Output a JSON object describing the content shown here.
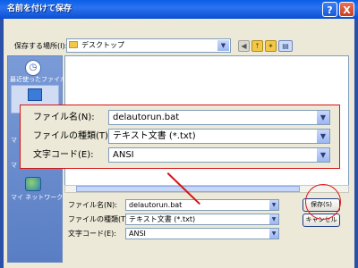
{
  "window": {
    "title": "名前を付けて保存",
    "help_glyph": "?",
    "close_glyph": "X"
  },
  "look_in": {
    "label": "保存する場所(I):",
    "value": "デスクトップ"
  },
  "toolbar": {
    "icons": [
      "back-icon",
      "up-folder-icon",
      "new-folder-icon",
      "view-menu-icon"
    ]
  },
  "places": {
    "recent_label": "最近使ったファイル",
    "partial_label_1": "マ",
    "partial_label_2": "マ",
    "network_label": "マイ ネットワーク"
  },
  "form": {
    "filename_label": "ファイル名(N):",
    "filename_value": "delautorun.bat",
    "filetype_label": "ファイルの種類(T):",
    "filetype_value": "テキスト文書 (*.txt)",
    "encoding_label": "文字コード(E):",
    "encoding_value": "ANSI"
  },
  "buttons": {
    "save_label": "保存(S)",
    "cancel_label": "キャンセル"
  },
  "zoom": {
    "filename_label": "ファイル名(N):",
    "filename_value": "delautorun.bat",
    "filetype_label": "ファイルの種類(T):",
    "filetype_value": "テキスト文書 (*.txt)",
    "encoding_label": "文字コード(E):",
    "encoding_value": "ANSI"
  },
  "colors": {
    "title_bar": "#0a5ee6",
    "dialog_bg": "#ece9d8",
    "highlight_red": "#d51515",
    "places_bar": "#6a8ccf"
  }
}
